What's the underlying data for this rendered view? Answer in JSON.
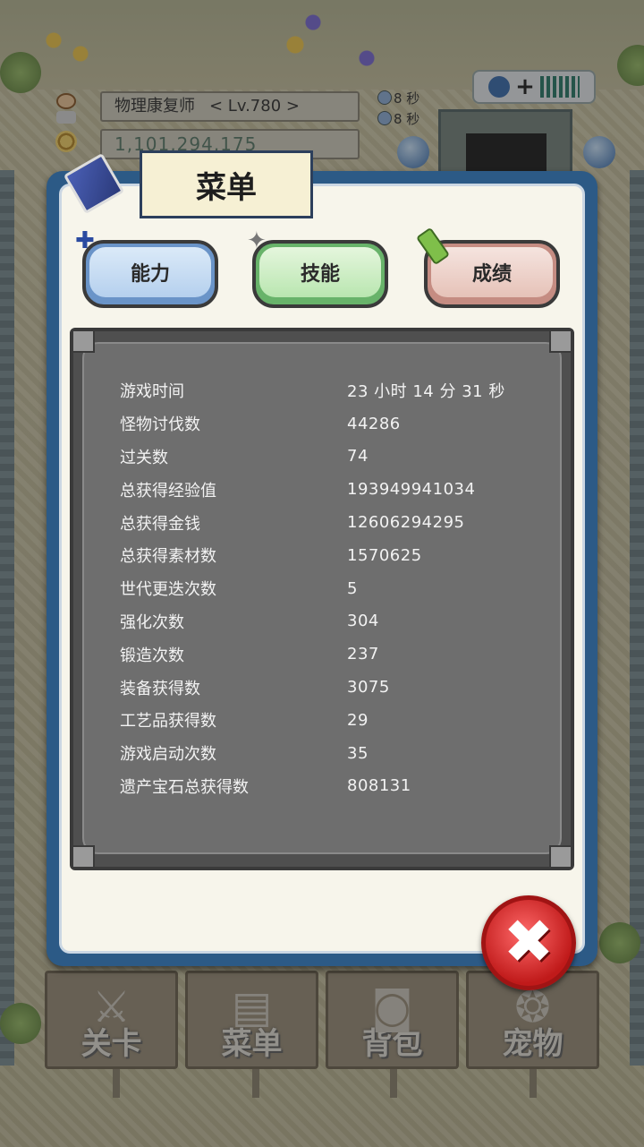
{
  "hud": {
    "job_name": "物理康复师",
    "level": "< Lv.780 >",
    "gold": "1,101,294,175",
    "timer_1": "8 秒",
    "timer_2": "8 秒"
  },
  "menu": {
    "title": "菜单",
    "tabs": [
      "能力",
      "技能",
      "成绩"
    ],
    "stats": [
      {
        "label": "游戏时间",
        "value": "23 小时 14 分 31 秒"
      },
      {
        "label": "怪物讨伐数",
        "value": "44286"
      },
      {
        "label": "过关数",
        "value": "74"
      },
      {
        "label": "总获得经验值",
        "value": "193949941034"
      },
      {
        "label": "总获得金钱",
        "value": "12606294295"
      },
      {
        "label": "总获得素材数",
        "value": "1570625"
      },
      {
        "label": "世代更迭次数",
        "value": "5"
      },
      {
        "label": "强化次数",
        "value": "304"
      },
      {
        "label": "锻造次数",
        "value": "237"
      },
      {
        "label": "装备获得数",
        "value": "3075"
      },
      {
        "label": "工艺品获得数",
        "value": "29"
      },
      {
        "label": "游戏启动次数",
        "value": "35"
      },
      {
        "label": "遗产宝石总获得数",
        "value": "808131"
      }
    ]
  },
  "bottom_nav": [
    "关卡",
    "菜单",
    "背包",
    "宠物"
  ],
  "colors": {
    "panel_border": "#2c5a86",
    "board": "#6e6e6e",
    "close": "#d32626"
  }
}
